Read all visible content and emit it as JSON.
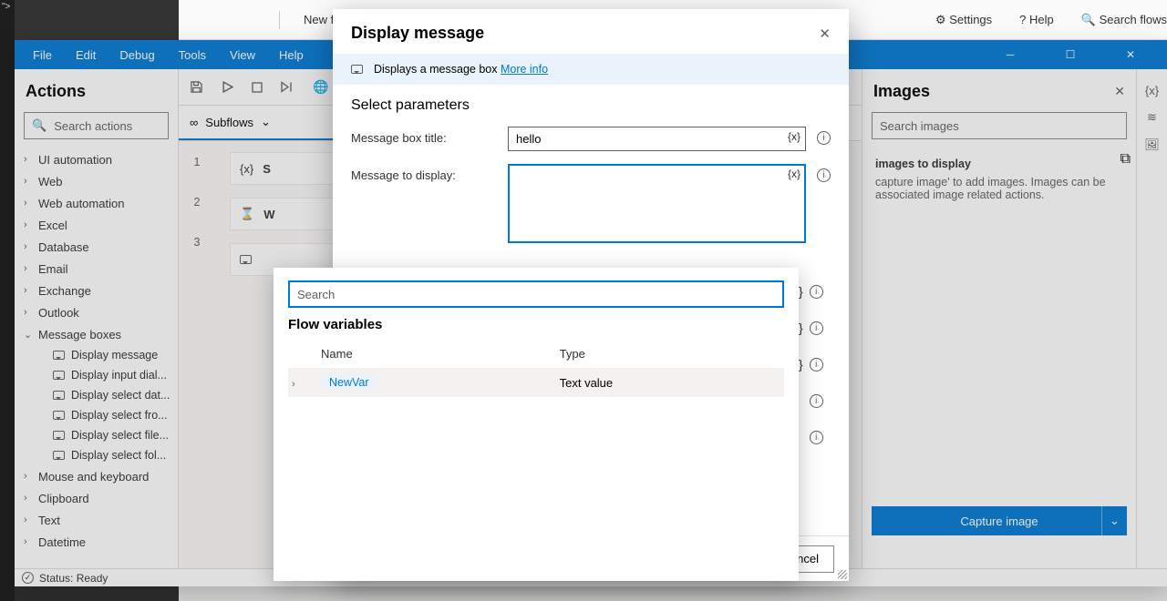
{
  "editor_top": {
    "new_flow": "New flow",
    "settings": "Settings",
    "help": "Help",
    "search_flows": "Search flows"
  },
  "menubar": {
    "items": [
      "File",
      "Edit",
      "Debug",
      "Tools",
      "View",
      "Help"
    ]
  },
  "status": {
    "label": "Status: Ready"
  },
  "actions": {
    "title": "Actions",
    "search_placeholder": "Search actions",
    "groups": [
      {
        "label": "UI automation"
      },
      {
        "label": "Web"
      },
      {
        "label": "Web automation"
      },
      {
        "label": "Excel"
      },
      {
        "label": "Database"
      },
      {
        "label": "Email"
      },
      {
        "label": "Exchange"
      },
      {
        "label": "Outlook"
      },
      {
        "label": "Message boxes",
        "open": true,
        "children": [
          "Display message",
          "Display input dial...",
          "Display select dat...",
          "Display select fro...",
          "Display select file...",
          "Display select fol..."
        ]
      },
      {
        "label": "Mouse and keyboard"
      },
      {
        "label": "Clipboard"
      },
      {
        "label": "Text"
      },
      {
        "label": "Datetime"
      }
    ]
  },
  "subflows_label": "Subflows",
  "canvas": {
    "lines": [
      "1",
      "2",
      "3"
    ],
    "step1_prefix": "S",
    "step2_prefix": "W"
  },
  "images": {
    "title": "Images",
    "close": "✕",
    "search_placeholder": "Search images",
    "empty_title": "images to display",
    "empty_body": "capture image' to add images. Images can be associated image related actions.",
    "capture": "Capture image"
  },
  "dialog": {
    "title": "Display message",
    "info_text": "Displays a message box ",
    "info_link": "More info",
    "section": "Select parameters",
    "params": {
      "title_label": "Message box title:",
      "title_value": "hello",
      "msg_label": "Message to display:",
      "msg_value": ""
    },
    "cancel": "ncel"
  },
  "varpop": {
    "search_placeholder": "Search",
    "section": "Flow variables",
    "col_name": "Name",
    "col_type": "Type",
    "rows": [
      {
        "name": "NewVar",
        "type": "Text value"
      }
    ]
  },
  "fx_label": "{x}"
}
